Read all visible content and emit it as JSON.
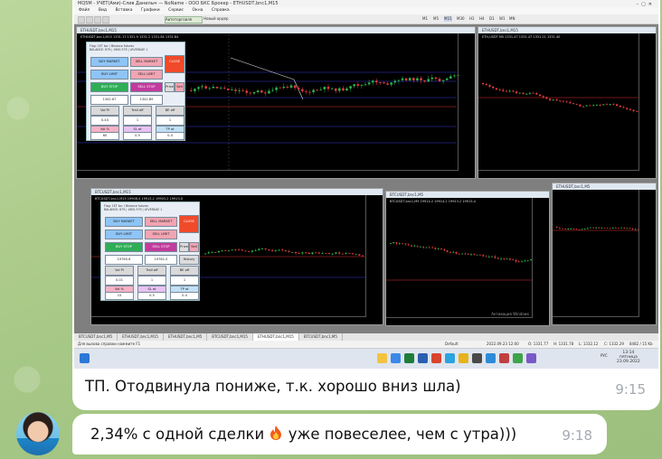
{
  "screenshot": {
    "title": "MQ5M - УЧЕТ(Ами)-Слив Данилыч — NoName - ООО БКС Брокер - ETHUSDT,bnc1,M15",
    "menu": [
      "Файл",
      "Вид",
      "Вставка",
      "Графики",
      "Сервис",
      "Окна",
      "Справка"
    ],
    "toolbar": {
      "algo_label": "Автоторговля",
      "new_order_label": "Новый ордер"
    },
    "timeframes": [
      "M1",
      "M5",
      "M15",
      "M30",
      "H1",
      "H4",
      "D1",
      "W1",
      "MN"
    ],
    "charts": [
      {
        "caption": "ETHUSDT,bnc1,M15",
        "info": "ETHUSDT,bnc1,M15  1331.17 1331.9 1331.2 1331.84 1331.84"
      },
      {
        "caption": "ETHUSDT,bnc1,M15",
        "info": "ETH,USDT M5 1331.47 1331.47 1331.21 1331.40"
      },
      {
        "caption": "BTCUSDT,bnc1,M15",
        "info": "BTCUSDT,bnc1,M15  19906.4 19913.2 19903.2 19913.0"
      },
      {
        "caption": "BTCUSDT,bnc1,M5",
        "info": "BTCUSDT,bnc1,M5  19914.2 19914.2 19913.2 19913.4"
      },
      {
        "caption": "ETHUSDT,bnc1,M5",
        "info": ""
      }
    ],
    "panel": {
      "header": "Flag: 1ET bcr / Binance futures\nBALANCE: 879 | 1600.379 | LEVERAGE 1",
      "buy_market": "BUY MARKET",
      "sell_market": "SELL MARKET",
      "close": "CLOSE",
      "buy_limit": "BUY LIMIT",
      "sell_limit": "SELL LIMIT",
      "buy_stop": "BUY STOP",
      "sell_stop": "SELL STOP",
      "price_label": "Price",
      "sell_short": "Sell",
      "price1": "1342.67",
      "price2": "1341.89",
      "vol_label": "Vol Pl",
      "trail_label": "Trail off",
      "be_label": "BE off",
      "vol_val": "0.43",
      "trail_val": "1",
      "be_val": "1",
      "risk_label": "Vol %",
      "sl_label": "SL ot",
      "tp_label": "TP ot",
      "risk_val": "60",
      "sl_val": "0.5",
      "tp_val": "0.4",
      "close_sub": "CLOSE 0"
    },
    "panel2": {
      "price1": "19765.6",
      "price2": "19761.0",
      "vol_val": "0.01",
      "trail_val": "1",
      "be_val": "1",
      "risk_val": "15",
      "sl_val": "0.5",
      "tp_val": "0.4",
      "history_label": "History",
      "sell_short": "Sell"
    },
    "tabs": [
      "BTCUSDT,bnc1,M5",
      "ETHUSDT,bnc1,M15",
      "ETHUSDT,bnc1,M5",
      "BTCUSDT,bnc1,M15",
      "ETHUSDT,bnc1,M15",
      "BTCUSDT,bnc1,M5"
    ],
    "status": {
      "left": "Для вызова справки нажмите F1",
      "profile": "Default",
      "time": "2022.09.23 12:00",
      "o": "O: 1331.77",
      "h": "H: 1331.78",
      "l": "L: 1332.12",
      "c": "C: 1332.29",
      "conn": "8482 / 15 Kb"
    },
    "watermark": "Активация Windows",
    "clock": {
      "time": "13:14",
      "day": "пятница",
      "date": "23.09.2022",
      "lang": "РУС"
    }
  },
  "messages": [
    {
      "text": "ТП. Отодвинула пониже, т.к. хорошо вниз шла)",
      "time": "9:15"
    },
    {
      "text_before": "2,34% с одной сделки ",
      "emoji": "fire",
      "text_after": " уже повеселее, чем с утра)))",
      "time": "9:18"
    }
  ],
  "colors": {
    "chart_bg": "#000000",
    "bull": "#2ab34a",
    "bear": "#e23b3b",
    "buy_blue": "#8ec4f6",
    "sell_pink": "#f2a4b2",
    "close_red": "#f04a2a",
    "stop_green": "#2fae57",
    "stop_magenta": "#c23b9d",
    "bubble": "#ffffff",
    "time_gray": "#a5aab0"
  }
}
